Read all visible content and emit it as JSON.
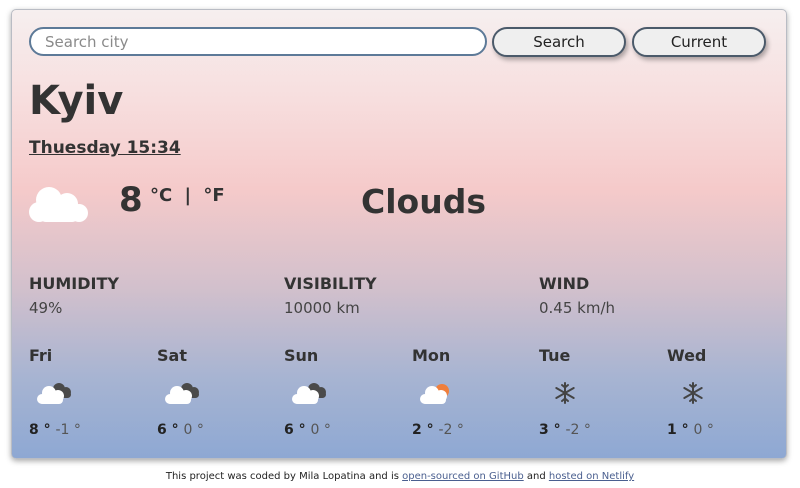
{
  "search": {
    "placeholder": "Search city",
    "search_label": "Search",
    "current_label": "Current"
  },
  "weather": {
    "city": "Kyiv",
    "datetime": "Thuesday 15:34",
    "temperature": "8",
    "unit_c": "°C",
    "unit_sep": "|",
    "unit_f": "°F",
    "description": "Clouds",
    "icon": "cloud-icon"
  },
  "stats": [
    {
      "label": "HUMIDITY",
      "value": "49%"
    },
    {
      "label": "VISIBILITY",
      "value": "10000 km"
    },
    {
      "label": "WIND",
      "value": "0.45 km/h"
    }
  ],
  "forecast": [
    {
      "day": "Fri",
      "icon": "broken-clouds-icon",
      "max": "8",
      "min": "-1"
    },
    {
      "day": "Sat",
      "icon": "broken-clouds-icon",
      "max": "6",
      "min": "0"
    },
    {
      "day": "Sun",
      "icon": "broken-clouds-icon",
      "max": "6",
      "min": "0"
    },
    {
      "day": "Mon",
      "icon": "sun-cloud-icon",
      "max": "2",
      "min": "-2"
    },
    {
      "day": "Tue",
      "icon": "snowflake-icon",
      "max": "3",
      "min": "-2"
    },
    {
      "day": "Wed",
      "icon": "snowflake-icon",
      "max": "1",
      "min": "0"
    }
  ],
  "footer": {
    "text_before": "This project was coded by Mila Lopatina and is ",
    "github_link": "open-sourced on GitHub",
    "text_mid": " and ",
    "netlify_link": "hosted on Netlify"
  },
  "colors": {
    "card_top": "#f6efef",
    "card_mid": "#f5caca",
    "card_bottom": "#8ea8d3",
    "sun": "#f07f3c"
  }
}
